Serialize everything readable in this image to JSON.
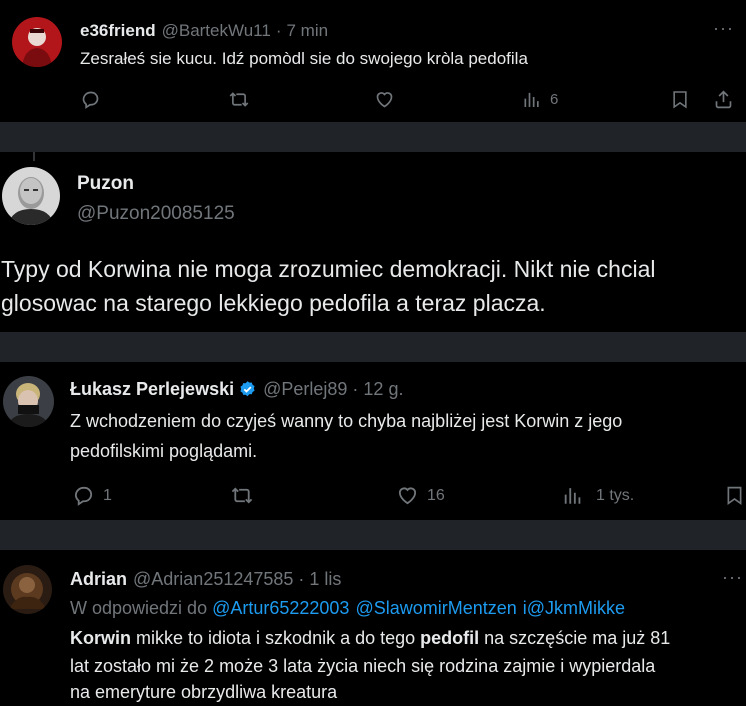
{
  "tweet1": {
    "name": "e36friend",
    "handle": "@BartekWu11",
    "dot": "·",
    "time": "7 min",
    "text": "Zesrałeś sie kucu. Idź pomòdl sie do swojego kròla pedofila",
    "views": "6",
    "more": "···"
  },
  "tweet2": {
    "name": "Puzon",
    "handle": "@Puzon20085125",
    "text_line1": "Typy od Korwina nie moga zrozumiec demokracji. Nikt nie chcial",
    "text_line2": "glosowac na starego lekkiego pedofila a teraz placza."
  },
  "tweet3": {
    "name": "Łukasz Perlejewski",
    "handle": "@Perlej89",
    "dot": "·",
    "time": "12 g.",
    "text_line1": "Z wchodzeniem do czyjeś wanny to chyba najbliżej jest Korwin z jego",
    "text_line2": "pedofilskimi poglądami.",
    "replies": "1",
    "likes": "16",
    "views": "1 tys."
  },
  "tweet4": {
    "name": "Adrian",
    "handle": "@Adrian251247585",
    "dot": "·",
    "time": "1 lis",
    "more": "···",
    "reply_prefix": "W odpowiedzi do ",
    "mention1": "@Artur65222003",
    "mention2": "@SlawomirMentzen",
    "mention3_prefix": "i",
    "mention3": "@JkmMikke",
    "line1_bold1": "Korwin",
    "line1_mid": " mikke to idiota i szkodnik a do tego ",
    "line1_bold2": "pedofil",
    "line1_end": " na szczęście ma już 81",
    "line2": "lat zostało mi że 2 może 3 lata życia niech się rodzina zajmie i wypierdala",
    "line3": "na emeryture obrzydliwa kreatura"
  },
  "colors": {
    "background": "#000000",
    "separator": "#202327",
    "text": "#e7e9ea",
    "muted": "#71767b",
    "link": "#1d9bf0",
    "verified": "#1d9bf0"
  },
  "icons": [
    "reply-icon",
    "retweet-icon",
    "like-icon",
    "views-icon",
    "bookmark-icon",
    "share-icon",
    "verified-badge-icon",
    "more-icon"
  ]
}
